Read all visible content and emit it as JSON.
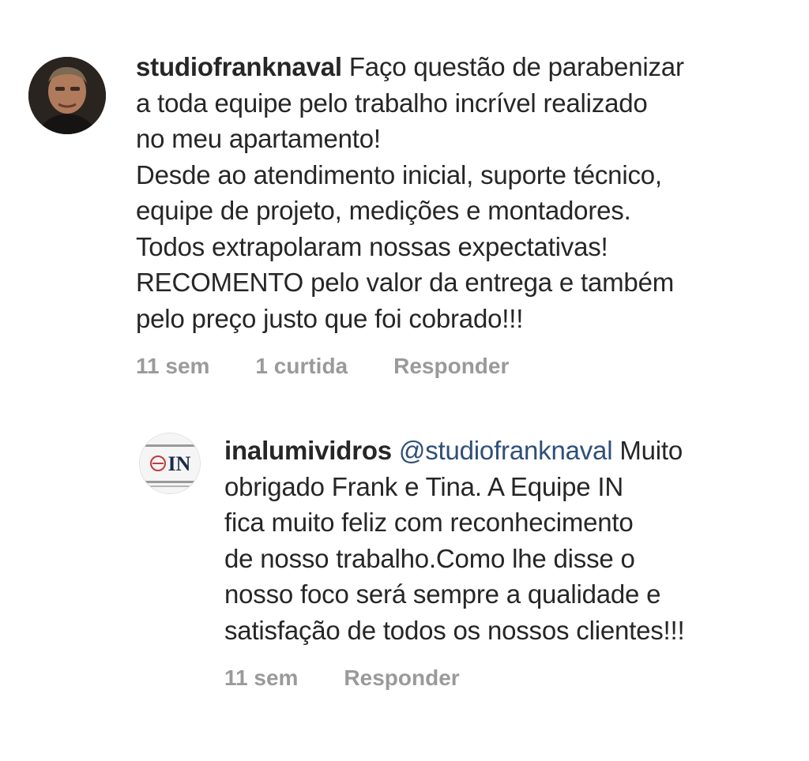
{
  "comments": [
    {
      "username": "studiofranknaval",
      "text": "Faço questão de parabenizar\na toda equipe pelo trabalho incrível realizado\nno meu apartamento!\nDesde ao atendimento inicial, suporte técnico,\nequipe de projeto, medições e montadores.\nTodos extrapolaram nossas expectativas!\nRECOMENTO pelo valor da entrega e também\npelo preço justo que foi cobrado!!!",
      "time": "11 sem",
      "likes": "1 curtida",
      "reply_label": "Responder",
      "avatar_icon": "user-photo-avatar"
    },
    {
      "username": "inalumividros",
      "mention": "@studiofranknaval",
      "text": "Muito\nobrigado Frank e Tina. A Equipe IN\nfica muito feliz com reconhecimento\nde nosso trabalho.Como lhe disse o\nnosso foco será sempre  a qualidade e\nsatisfação de todos os nossos clientes!!!",
      "time": "11 sem",
      "reply_label": "Responder",
      "avatar_logo_text": "IN",
      "avatar_icon": "brand-logo-avatar"
    }
  ],
  "colors": {
    "text": "#262626",
    "meta": "#9a9a9a",
    "mention": "#2f4f7a"
  }
}
